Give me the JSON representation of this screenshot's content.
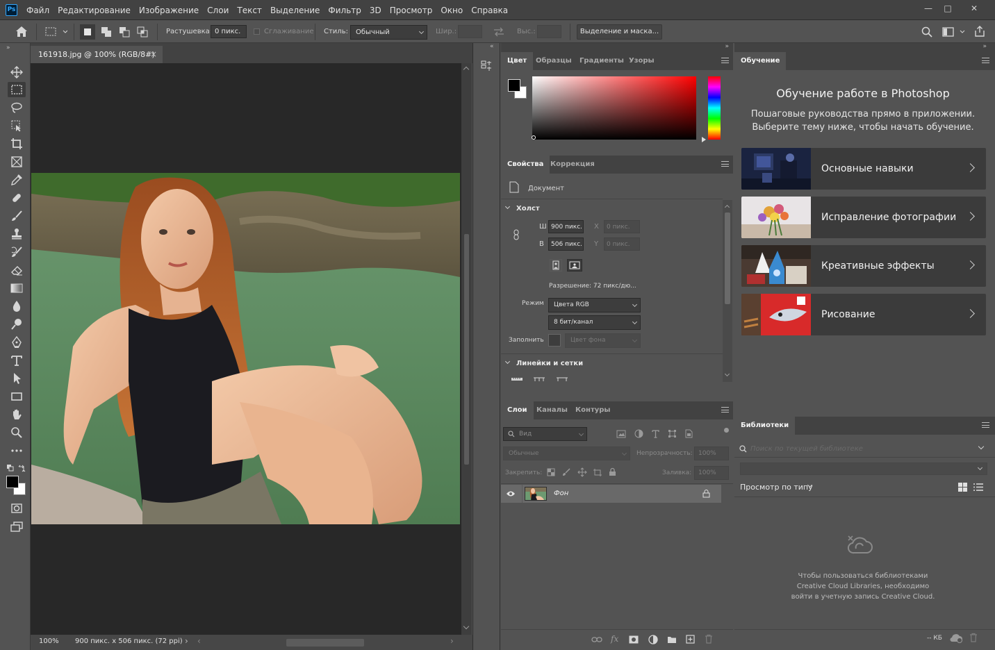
{
  "app": {
    "logo": "Ps"
  },
  "menu": [
    "Файл",
    "Редактирование",
    "Изображение",
    "Слои",
    "Текст",
    "Выделение",
    "Фильтр",
    "3D",
    "Просмотр",
    "Окно",
    "Справка"
  ],
  "window_controls": {
    "minimize": "—",
    "restore": "□",
    "close": "✕"
  },
  "options": {
    "feather_label": "Растушевка:",
    "feather_value": "0 пикс.",
    "antialias_label": "Сглаживание",
    "style_label": "Стиль:",
    "style_value": "Обычный",
    "width_label": "Шир.:",
    "height_label": "Выс.:",
    "select_mask_button": "Выделение и маска..."
  },
  "document": {
    "tab_title": "161918.jpg @ 100% (RGB/8#)",
    "tab_close": "×",
    "zoom": "100%",
    "status_info": "900 пикс. x 506 пикс. (72 ppi)"
  },
  "color_panel": {
    "tabs": [
      "Цвет",
      "Образцы",
      "Градиенты",
      "Узоры"
    ]
  },
  "properties_panel": {
    "tabs": [
      "Свойства",
      "Коррекция"
    ],
    "doc_label": "Документ",
    "canvas_section": "Холст",
    "w_label": "Ш",
    "w_value": "900 пикс.",
    "h_label": "В",
    "h_value": "506 пикс.",
    "x_label": "X",
    "x_value": "0 пикс.",
    "y_label": "Y",
    "y_value": "0 пикс.",
    "resolution": "Разрешение: 72 пикс/дю...",
    "mode_label": "Режим",
    "mode_value": "Цвета RGB",
    "depth_value": "8 бит/канал",
    "fill_label": "Заполнить",
    "fill_value": "Цвет фона",
    "rulers_section": "Линейки и сетки"
  },
  "layers_panel": {
    "tabs": [
      "Слои",
      "Каналы",
      "Контуры"
    ],
    "search_placeholder": "Вид",
    "blend_mode": "Обычные",
    "opacity_label": "Непрозрачность:",
    "opacity_value": "100%",
    "lock_label": "Закрепить:",
    "fill_label": "Заливка:",
    "fill_value": "100%",
    "layers": [
      {
        "name": "Фон"
      }
    ]
  },
  "learn_panel": {
    "tab": "Обучение",
    "title": "Обучение работе в Photoshop",
    "subtitle_1": "Пошаговые руководства прямо в приложении.",
    "subtitle_2": "Выберите тему ниже, чтобы начать обучение.",
    "cards": [
      {
        "label": "Основные навыки"
      },
      {
        "label": "Исправление фотографии"
      },
      {
        "label": "Креативные эффекты"
      },
      {
        "label": "Рисование"
      }
    ]
  },
  "libraries_panel": {
    "tab": "Библиотеки",
    "search_placeholder": "Поиск по текущей библиотеке",
    "view_by": "Просмотр по типу",
    "message_1": "Чтобы пользоваться библиотеками",
    "message_2": "Creative Cloud Libraries, необходимо",
    "message_3": "войти в учетную запись Creative Cloud.",
    "size": "-- КБ"
  },
  "colors": {
    "accent": "#31a8ff",
    "foreground": "#000000",
    "background": "#ffffff"
  }
}
